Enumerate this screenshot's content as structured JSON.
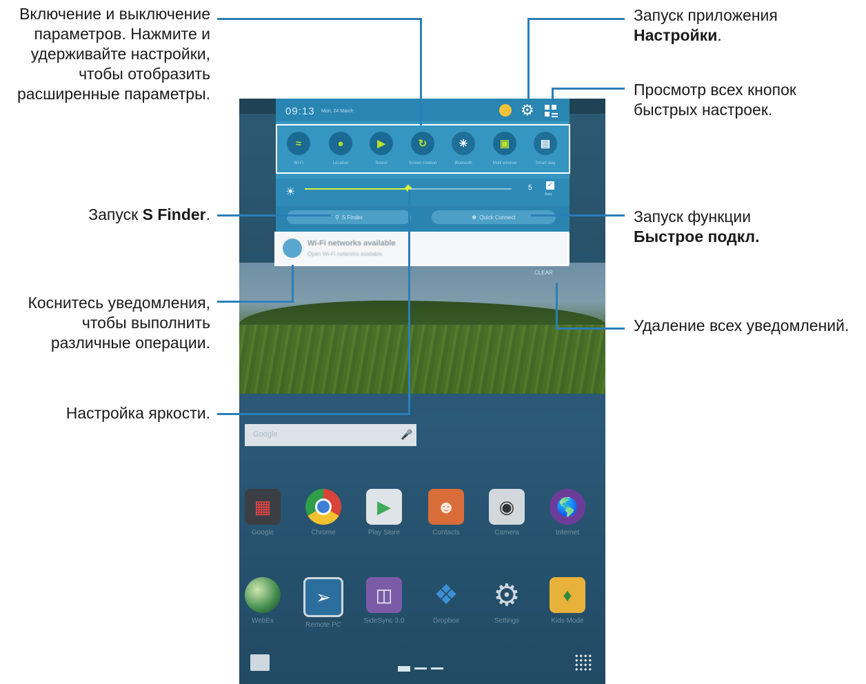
{
  "callouts": {
    "toggles": [
      "Включение и выключение",
      "параметров. Нажмите и",
      "удерживайте настройки,",
      "чтобы отобразить",
      "расширенные параметры."
    ],
    "settings_line1": "Запуск приложения",
    "settings_bold": "Настройки",
    "settings_period": ".",
    "quick_settings": [
      "Просмотр всех кнопок",
      "быстрых настроек."
    ],
    "sfinder_prefix": "Запуск ",
    "sfinder_bold": "S Finder",
    "sfinder_period": ".",
    "quick_connect_line1": "Запуск функции",
    "quick_connect_bold": "Быстрое подкл.",
    "notification": [
      "Коснитесь уведомления,",
      "чтобы выполнить",
      "различные операции."
    ],
    "clear_all": "Удаление всех уведомлений.",
    "brightness": "Настройка яркости."
  },
  "panel": {
    "time": "09:13",
    "date": "Mon, 24 March",
    "brightness_value": "5",
    "brightness_level": 0.5,
    "auto_label": "Auto",
    "s_finder": "S Finder",
    "quick_connect": "Quick Connect",
    "notification_title": "Wi-Fi networks available",
    "notification_sub": "Open Wi-Fi networks available",
    "clear": "CLEAR",
    "toggles": [
      {
        "label": "Wi-Fi",
        "icon": "wifi-icon",
        "on": true
      },
      {
        "label": "Location",
        "icon": "location-icon",
        "on": true
      },
      {
        "label": "Sound",
        "icon": "sound-icon",
        "on": true
      },
      {
        "label": "Screen rotation",
        "icon": "rotation-icon",
        "on": true
      },
      {
        "label": "Bluetooth",
        "icon": "bluetooth-icon",
        "on": false
      },
      {
        "label": "Multi window",
        "icon": "multiwindow-icon",
        "on": true
      },
      {
        "label": "Smart stay",
        "icon": "smart-stay-icon",
        "on": false
      }
    ]
  },
  "home": {
    "search_placeholder": "Google",
    "apps_row1": [
      "Google",
      "Chrome",
      "Play Store",
      "Contacts",
      "Camera",
      "Internet"
    ],
    "apps_row2": [
      "WebEx",
      "Remote PC",
      "SideSync 3.0",
      "Dropbox",
      "Settings",
      "Kids Mode"
    ]
  },
  "colors": {
    "leader": "#2a7fb8",
    "panel": "#2a86b3",
    "toggle_on": "#b8e02e"
  }
}
